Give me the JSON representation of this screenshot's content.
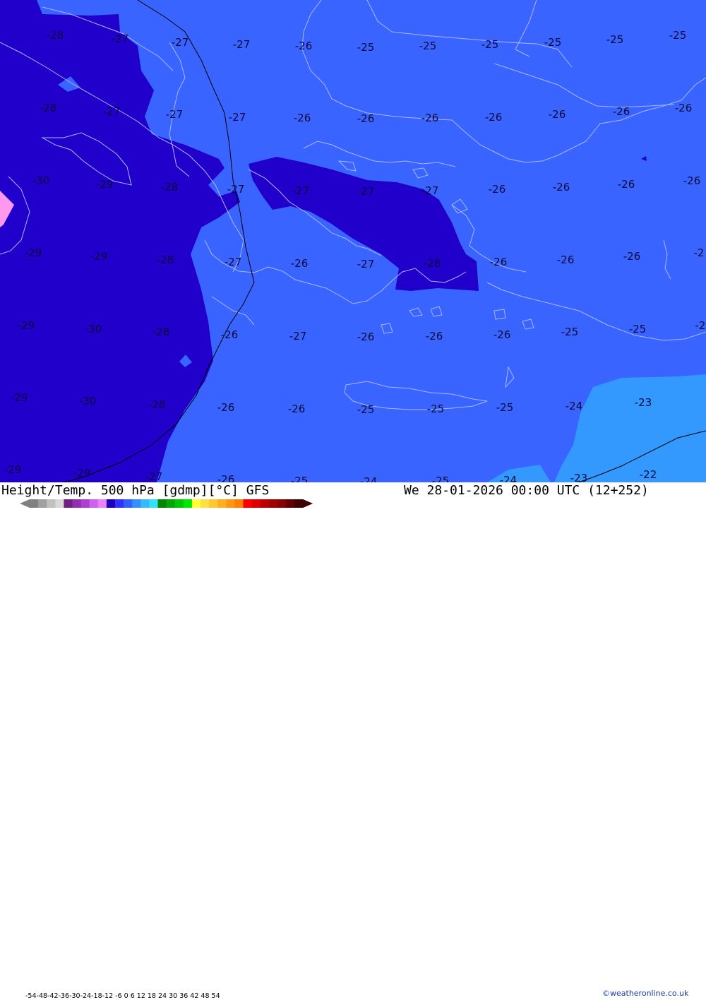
{
  "title_left": "Height/Temp. 500 hPa [gdmp][°C] GFS",
  "title_right": "We 28-01-2026 00:00 UTC (12+252)",
  "credit": "©weatheronline.co.uk",
  "scale_ticks": "-54-48-42-36-30-24-18-12 -6  0  6  12  18  24  30  36  42  48  54",
  "colors": {
    "band_minus30_minus24": "#3a64ff",
    "band_minus36_minus30": "#2200cc",
    "band_minus24_minus18": "#3399ff",
    "band_pink": "#ff99ee",
    "coast": "#a8b8ff",
    "contour": "#000000"
  },
  "scale_colors": [
    "#808080",
    "#a0a0a0",
    "#c0c0c0",
    "#d8d8d8",
    "#702080",
    "#9030b0",
    "#b040d0",
    "#d060f0",
    "#f080ff",
    "#2000c0",
    "#3030ff",
    "#3060ff",
    "#3390ff",
    "#33bbff",
    "#33e0ff",
    "#008800",
    "#00a800",
    "#00c800",
    "#00e800",
    "#ffff33",
    "#ffe040",
    "#ffc830",
    "#ffb020",
    "#ff9810",
    "#ff8000",
    "#ff0000",
    "#e00000",
    "#c00000",
    "#a00000",
    "#880000",
    "#600000",
    "#400000"
  ],
  "labels": [
    {
      "t": "-28"
    },
    {
      "t": "-27"
    },
    {
      "t": "-27"
    },
    {
      "t": "-27"
    },
    {
      "t": "-26"
    },
    {
      "t": "-25"
    },
    {
      "t": "-25"
    },
    {
      "t": "-25"
    },
    {
      "t": "-25"
    },
    {
      "t": "-25"
    },
    {
      "t": "-25"
    },
    {
      "t": "-28"
    },
    {
      "t": "-27"
    },
    {
      "t": "-27"
    },
    {
      "t": "-27"
    },
    {
      "t": "-26"
    },
    {
      "t": "-26"
    },
    {
      "t": "-26"
    },
    {
      "t": "-26"
    },
    {
      "t": "-26"
    },
    {
      "t": "-26"
    },
    {
      "t": "-26"
    },
    {
      "t": "-30"
    },
    {
      "t": "-29"
    },
    {
      "t": "-28"
    },
    {
      "t": "-27"
    },
    {
      "t": "-27"
    },
    {
      "t": "-27"
    },
    {
      "t": "-27"
    },
    {
      "t": "-26"
    },
    {
      "t": "-26"
    },
    {
      "t": "-26"
    },
    {
      "t": "-26"
    },
    {
      "t": "-29"
    },
    {
      "t": "-29"
    },
    {
      "t": "-28"
    },
    {
      "t": "-27"
    },
    {
      "t": "-26"
    },
    {
      "t": "-27"
    },
    {
      "t": "-28"
    },
    {
      "t": "-26"
    },
    {
      "t": "-26"
    },
    {
      "t": "-26"
    },
    {
      "t": "-2"
    },
    {
      "t": "-29"
    },
    {
      "t": "-30"
    },
    {
      "t": "-28"
    },
    {
      "t": "-26"
    },
    {
      "t": "-27"
    },
    {
      "t": "-26"
    },
    {
      "t": "-26"
    },
    {
      "t": "-26"
    },
    {
      "t": "-25"
    },
    {
      "t": "-25"
    },
    {
      "t": "-2"
    },
    {
      "t": "-29"
    },
    {
      "t": "-30"
    },
    {
      "t": "-28"
    },
    {
      "t": "-26"
    },
    {
      "t": "-26"
    },
    {
      "t": "-25"
    },
    {
      "t": "-25"
    },
    {
      "t": "-25"
    },
    {
      "t": "-24"
    },
    {
      "t": "-23"
    },
    {
      "t": "-29"
    },
    {
      "t": "-29"
    },
    {
      "t": "-27"
    },
    {
      "t": "-26"
    },
    {
      "t": "-25"
    },
    {
      "t": "-24"
    },
    {
      "t": "-25"
    },
    {
      "t": "-24"
    },
    {
      "t": "-23"
    },
    {
      "t": "-22"
    }
  ]
}
